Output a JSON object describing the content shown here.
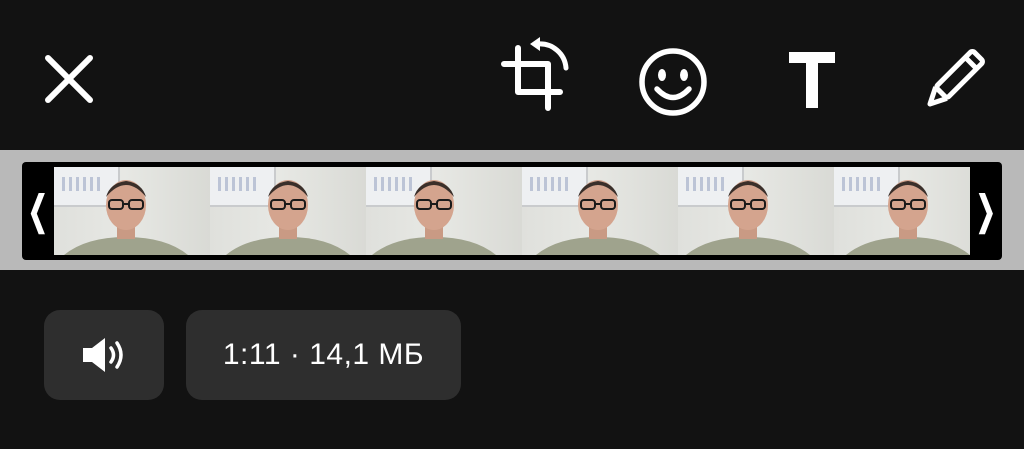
{
  "toolbar": {
    "close_icon": "close-icon",
    "crop_icon": "crop-rotate-icon",
    "emoji_icon": "smiley-icon",
    "text_icon": "text-icon",
    "text_glyph": "T",
    "draw_icon": "pencil-icon"
  },
  "timeline": {
    "left_handle": "❮",
    "right_handle": "❯",
    "frame_count": 6
  },
  "controls": {
    "sound_icon": "speaker-icon",
    "info_text": "1:11 · 14,1 МБ"
  },
  "colors": {
    "background": "#121212",
    "timeline_band": "#b9b9b9",
    "pill": "#2e2e2e",
    "icon": "#ffffff"
  }
}
